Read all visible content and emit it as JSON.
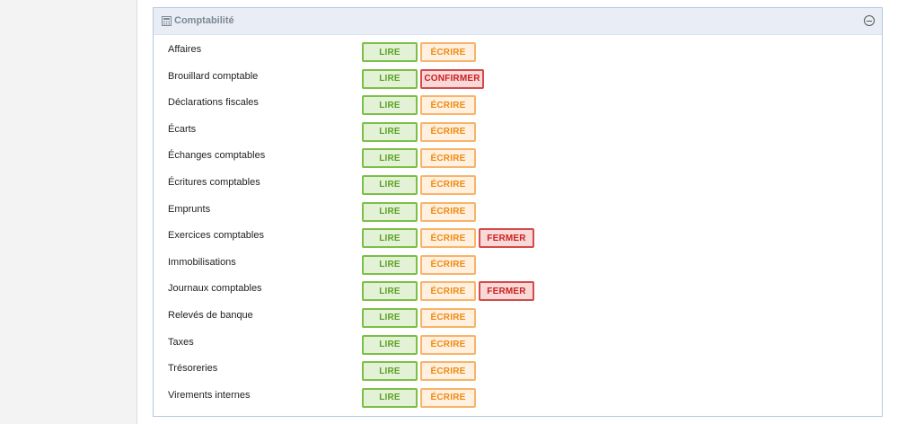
{
  "panel": {
    "title": "Comptabilité",
    "icon": "calculator-icon",
    "collapse_icon": "minus-circle-icon"
  },
  "colors": {
    "read": "#5aa223",
    "write": "#f08a10",
    "danger": "#cc1e1e",
    "header_bg": "#e9eef6"
  },
  "rows": [
    {
      "label": "Affaires",
      "read": "LIRE",
      "write": "ÉCRIRE"
    },
    {
      "label": "Brouillard comptable",
      "read": "LIRE",
      "confirm": "CONFIRMER"
    },
    {
      "label": "Déclarations fiscales",
      "read": "LIRE",
      "write": "ÉCRIRE"
    },
    {
      "label": "Écarts",
      "read": "LIRE",
      "write": "ÉCRIRE"
    },
    {
      "label": "Échanges comptables",
      "read": "LIRE",
      "write": "ÉCRIRE"
    },
    {
      "label": "Écritures comptables",
      "read": "LIRE",
      "write": "ÉCRIRE"
    },
    {
      "label": "Emprunts",
      "read": "LIRE",
      "write": "ÉCRIRE"
    },
    {
      "label": "Exercices comptables",
      "read": "LIRE",
      "write": "ÉCRIRE",
      "close": "FERMER"
    },
    {
      "label": "Immobilisations",
      "read": "LIRE",
      "write": "ÉCRIRE"
    },
    {
      "label": "Journaux comptables",
      "read": "LIRE",
      "write": "ÉCRIRE",
      "close": "FERMER"
    },
    {
      "label": "Relevés de banque",
      "read": "LIRE",
      "write": "ÉCRIRE"
    },
    {
      "label": "Taxes",
      "read": "LIRE",
      "write": "ÉCRIRE"
    },
    {
      "label": "Trésoreries",
      "read": "LIRE",
      "write": "ÉCRIRE"
    },
    {
      "label": "Virements internes",
      "read": "LIRE",
      "write": "ÉCRIRE"
    }
  ]
}
